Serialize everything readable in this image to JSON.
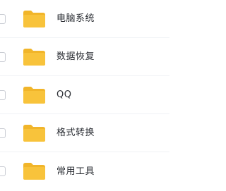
{
  "file_list": {
    "items": [
      {
        "name": "电脑系统",
        "checked": false,
        "icon": "folder-icon"
      },
      {
        "name": "数据恢复",
        "checked": false,
        "icon": "folder-icon"
      },
      {
        "name": "QQ",
        "checked": false,
        "icon": "folder-icon"
      },
      {
        "name": "格式转换",
        "checked": false,
        "icon": "folder-icon"
      },
      {
        "name": "常用工具",
        "checked": false,
        "icon": "folder-icon"
      }
    ]
  },
  "colors": {
    "folder": "#f8c33b",
    "folder_tab": "#f1b52a",
    "text": "#2a2d33",
    "checkbox_border": "#c9ccd3"
  }
}
